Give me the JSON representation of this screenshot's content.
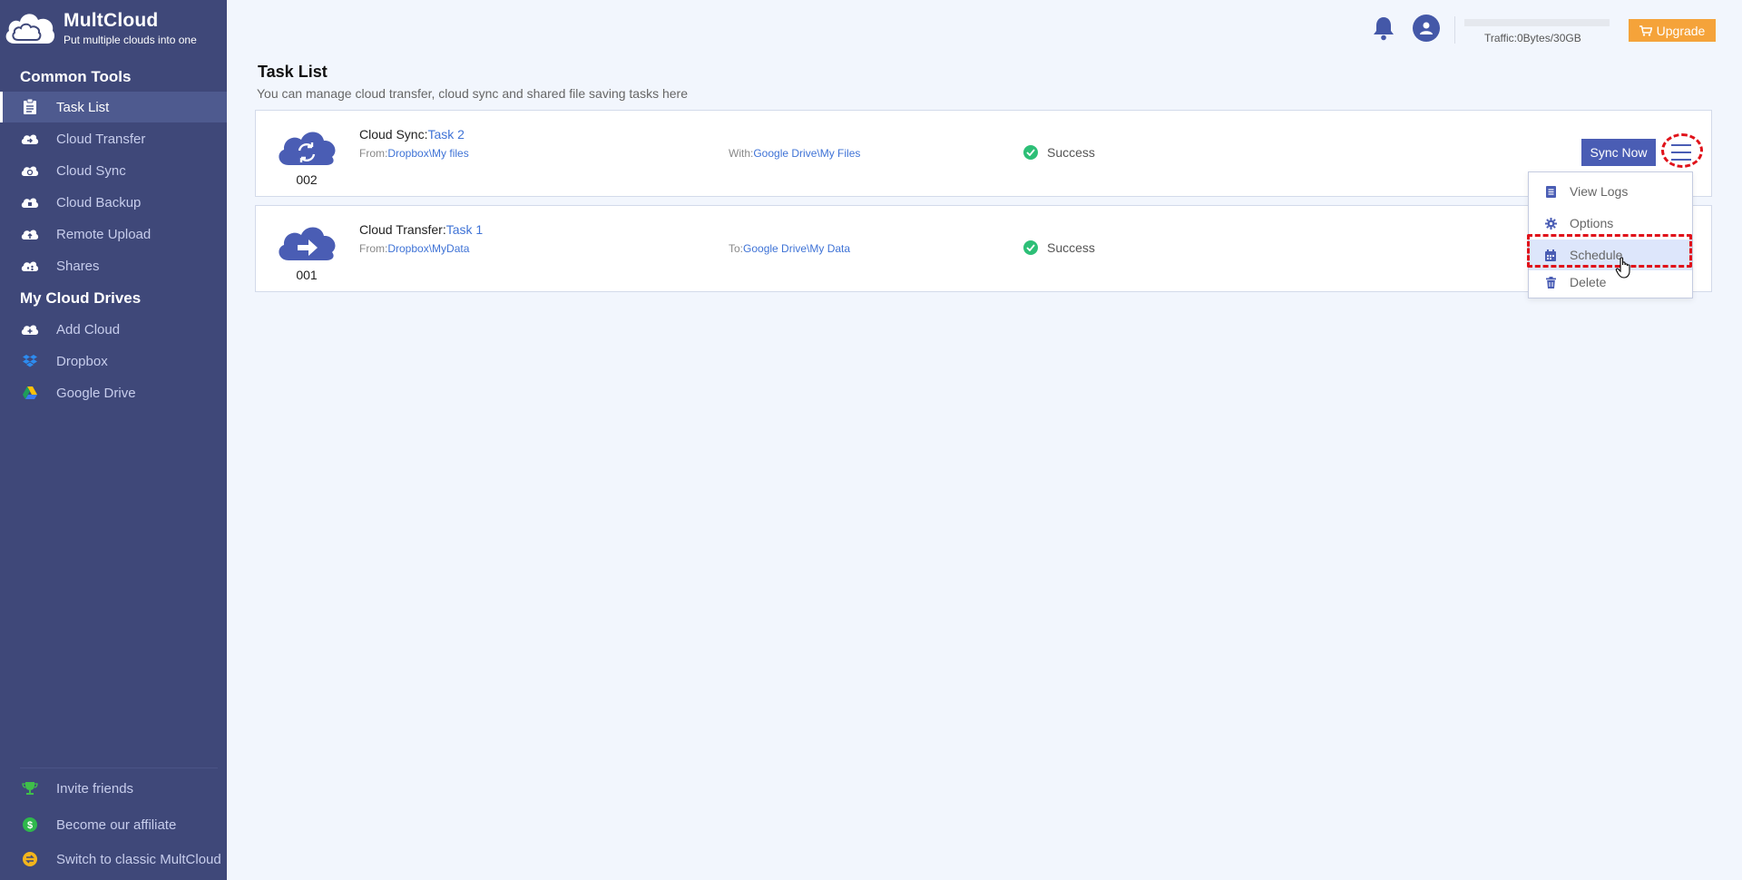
{
  "brand": {
    "name": "MultCloud",
    "tagline": "Put multiple clouds into one"
  },
  "sidebar": {
    "common_tools_title": "Common Tools",
    "common_tools": [
      {
        "label": "Task List",
        "icon": "clipboard-icon",
        "active": true
      },
      {
        "label": "Cloud Transfer",
        "icon": "cloud-transfer-icon"
      },
      {
        "label": "Cloud Sync",
        "icon": "cloud-sync-icon"
      },
      {
        "label": "Cloud Backup",
        "icon": "cloud-backup-icon"
      },
      {
        "label": "Remote Upload",
        "icon": "cloud-upload-icon"
      },
      {
        "label": "Shares",
        "icon": "cloud-share-icon"
      }
    ],
    "drives_title": "My Cloud Drives",
    "drives": [
      {
        "label": "Add Cloud",
        "icon": "cloud-add-icon"
      },
      {
        "label": "Dropbox",
        "icon": "dropbox-icon"
      },
      {
        "label": "Google Drive",
        "icon": "google-drive-icon"
      }
    ],
    "footer": [
      {
        "label": "Invite friends",
        "icon": "trophy-icon"
      },
      {
        "label": "Become our affiliate",
        "icon": "dollar-icon"
      },
      {
        "label": "Switch to classic MultCloud",
        "icon": "switch-icon"
      }
    ]
  },
  "topbar": {
    "traffic": "Traffic:0Bytes/30GB",
    "upgrade_label": "Upgrade"
  },
  "main": {
    "title": "Task List",
    "subtitle": "You can manage cloud transfer, cloud sync and shared file saving tasks here",
    "tasks": [
      {
        "number": "002",
        "type_label": "Cloud Sync:",
        "name": "Task 2",
        "from_label": "From:",
        "from_path": "Dropbox\\My files",
        "to_label": "With:",
        "to_path": "Google Drive\\My Files",
        "status": "Success",
        "icon": "cloud-sync-icon"
      },
      {
        "number": "001",
        "type_label": "Cloud Transfer:",
        "name": "Task 1",
        "from_label": "From:",
        "from_path": "Dropbox\\MyData",
        "to_label": "To:",
        "to_path": "Google Drive\\My Data",
        "status": "Success",
        "icon": "cloud-transfer-icon"
      }
    ],
    "sync_now_label": "Sync Now",
    "dropdown": [
      {
        "label": "View Logs",
        "icon": "log-icon"
      },
      {
        "label": "Options",
        "icon": "gear-icon"
      },
      {
        "label": "Schedule",
        "icon": "calendar-icon",
        "highlighted": true
      },
      {
        "label": "Delete",
        "icon": "trash-icon"
      }
    ]
  },
  "colors": {
    "sidebar_bg": "#3f4879",
    "accent": "#4a5db4",
    "upgrade": "#f5a33a",
    "success": "#2dbf77",
    "link": "#3f73d6",
    "highlight": "#e0121a"
  }
}
